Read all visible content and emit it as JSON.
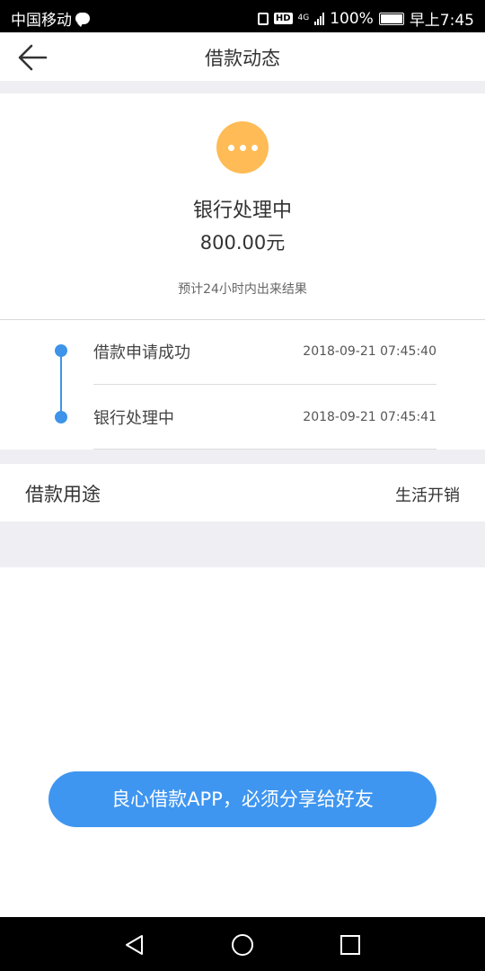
{
  "status_bar": {
    "carrier": "中国移动",
    "network": "4G",
    "battery": "100%",
    "time": "早上7:45"
  },
  "header": {
    "title": "借款动态"
  },
  "status": {
    "title": "银行处理中",
    "amount": "800.00元",
    "note": "预计24小时内出来结果",
    "icon": "more-dots-icon",
    "icon_color": "#ffbb55"
  },
  "timeline": [
    {
      "label": "借款申请成功",
      "time": "2018-09-21 07:45:40"
    },
    {
      "label": "银行处理中",
      "time": "2018-09-21 07:45:41"
    }
  ],
  "purpose": {
    "label": "借款用途",
    "value": "生活开销"
  },
  "share_button": {
    "label": "良心借款APP，必须分享给好友",
    "color": "#3f96f0"
  },
  "accent_color": "#3d94e8"
}
